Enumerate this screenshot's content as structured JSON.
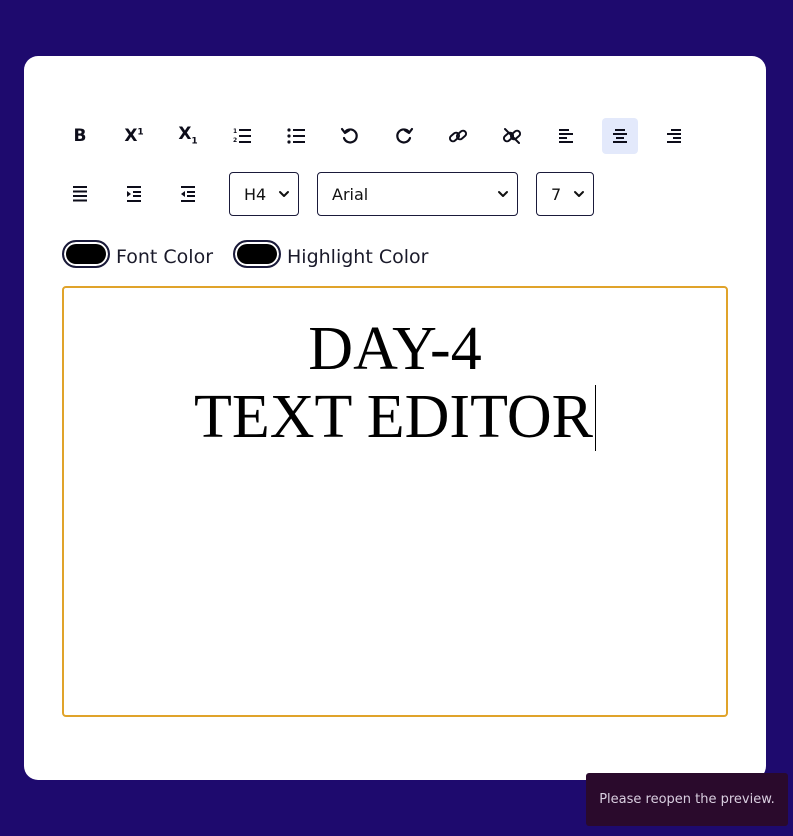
{
  "toolbar": {
    "buttons": [
      {
        "name": "bold",
        "glyph": "B"
      },
      {
        "name": "superscript",
        "glyph": "X",
        "mark": "1"
      },
      {
        "name": "subscript",
        "glyph": "X",
        "mark": "1"
      },
      {
        "name": "ordered-list"
      },
      {
        "name": "unordered-list"
      },
      {
        "name": "undo"
      },
      {
        "name": "redo"
      },
      {
        "name": "link"
      },
      {
        "name": "unlink"
      },
      {
        "name": "align-left"
      },
      {
        "name": "align-center",
        "active": true
      },
      {
        "name": "align-right"
      },
      {
        "name": "justify"
      },
      {
        "name": "indent"
      },
      {
        "name": "outdent"
      }
    ],
    "heading_select": "H4",
    "font_select": "Arial",
    "size_select": "7"
  },
  "colors": {
    "font_color_label": "Font Color",
    "highlight_color_label": "Highlight Color",
    "font_color_value": "#000000",
    "highlight_color_value": "#000000"
  },
  "editor": {
    "line1": "DAY-4",
    "line2": "TEXT EDITOR",
    "border_color": "#e0a32a"
  },
  "toast": {
    "message": "Please reopen the preview."
  },
  "theme": {
    "background": "#1e0a6e",
    "card": "#ffffff",
    "active_button": "#e3e9fb"
  }
}
